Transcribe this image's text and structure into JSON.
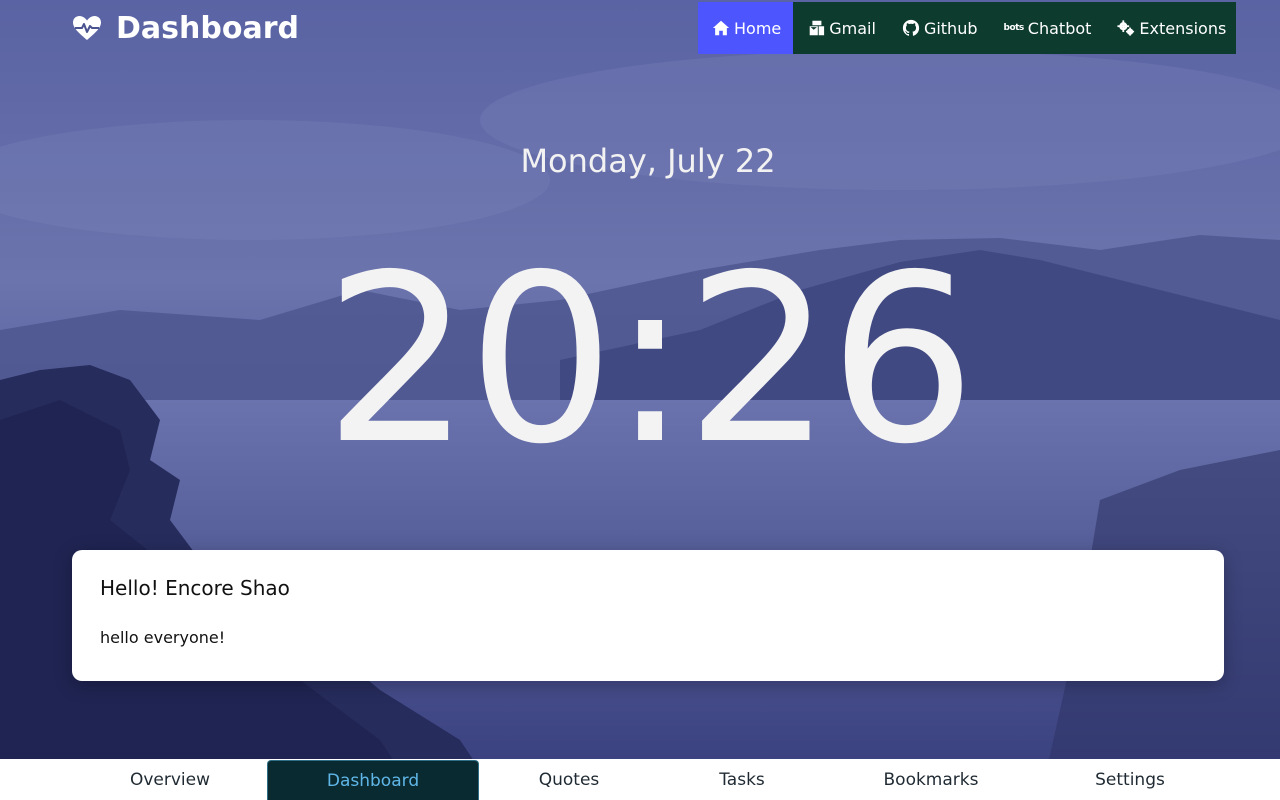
{
  "brand": {
    "title": "Dashboard",
    "icon": "heartbeat-icon"
  },
  "nav": {
    "items": [
      {
        "label": "Home",
        "icon": "home-icon",
        "active": true
      },
      {
        "label": "Gmail",
        "icon": "mail-bulk-icon",
        "active": false
      },
      {
        "label": "Github",
        "icon": "github-icon",
        "active": false
      },
      {
        "label": "Chatbot",
        "icon": "bots-icon",
        "icon_text": "bots",
        "active": false
      },
      {
        "label": "Extensions",
        "icon": "cogs-icon",
        "active": false
      }
    ]
  },
  "clock": {
    "date": "Monday, July 22",
    "time": "20:26"
  },
  "card": {
    "title": "Hello! Encore Shao",
    "message": "hello everyone!"
  },
  "tabs": [
    {
      "label": "Overview",
      "active": false
    },
    {
      "label": "Dashboard",
      "active": true
    },
    {
      "label": "Quotes",
      "active": false
    },
    {
      "label": "Tasks",
      "active": false
    },
    {
      "label": "Bookmarks",
      "active": false
    },
    {
      "label": "Settings",
      "active": false
    }
  ],
  "colors": {
    "nav_bg": "#0d3b2e",
    "nav_active": "#4d55ff",
    "tab_active_bg": "#0a2a32",
    "tab_active_text": "#5fb6e6"
  }
}
